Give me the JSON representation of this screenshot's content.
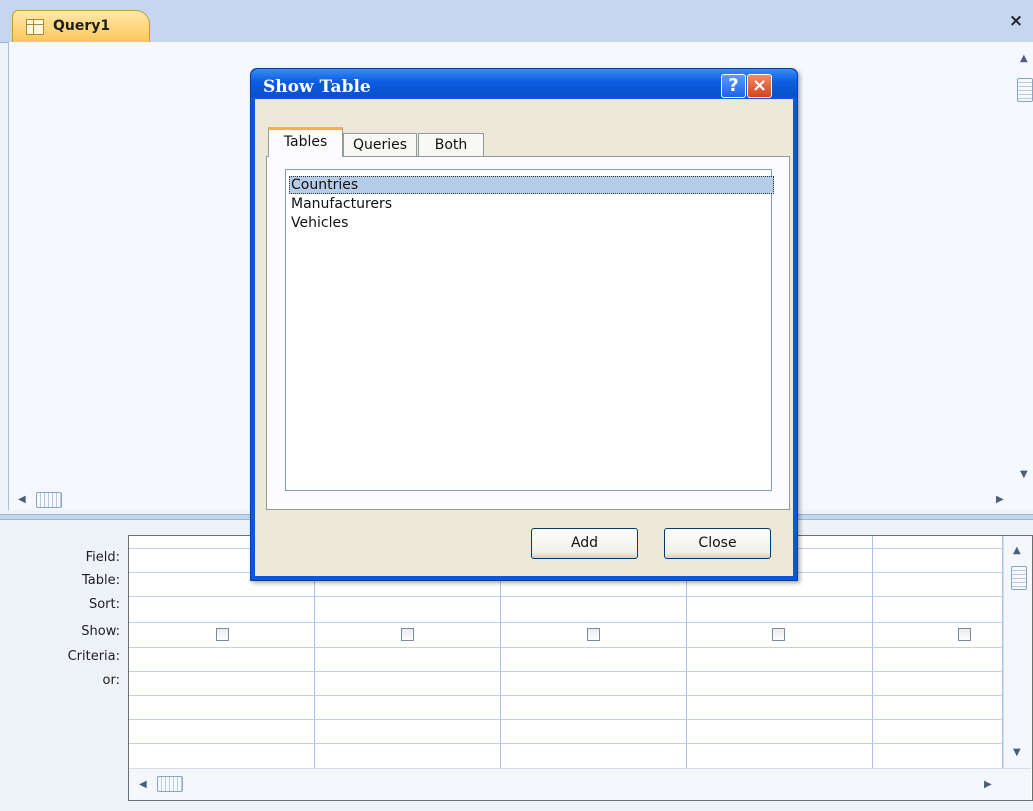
{
  "document_tab": {
    "title": "Query1",
    "close_glyph": "×"
  },
  "upper_pane": {
    "scroll_up": "▲",
    "scroll_down": "▼",
    "scroll_left": "◀",
    "scroll_right": "▶"
  },
  "design_grid": {
    "row_labels": [
      "Field:",
      "Table:",
      "Sort:",
      "Show:",
      "Criteria:",
      "or:"
    ],
    "columns": [
      {
        "show": false
      },
      {
        "show": false
      },
      {
        "show": false
      },
      {
        "show": false
      },
      {
        "show": false
      }
    ],
    "scroll_up": "▲",
    "scroll_down": "▼",
    "scroll_left": "◀",
    "scroll_right": "▶"
  },
  "dialog": {
    "title": "Show Table",
    "help_glyph": "?",
    "close_glyph": "×",
    "tabs": [
      {
        "label": "Tables",
        "active": true
      },
      {
        "label": "Queries",
        "active": false
      },
      {
        "label": "Both",
        "active": false
      }
    ],
    "items": [
      {
        "label": "Countries",
        "selected": true
      },
      {
        "label": "Manufacturers",
        "selected": false
      },
      {
        "label": "Vehicles",
        "selected": false
      }
    ],
    "add_label": "Add",
    "close_label": "Close"
  },
  "colors": {
    "accent_tab": "#ffd57a",
    "title_bar": "#0a5de0",
    "selection": "#b6cdea"
  },
  "icons": [
    "query-icon",
    "close-icon",
    "help-icon",
    "checkbox"
  ]
}
